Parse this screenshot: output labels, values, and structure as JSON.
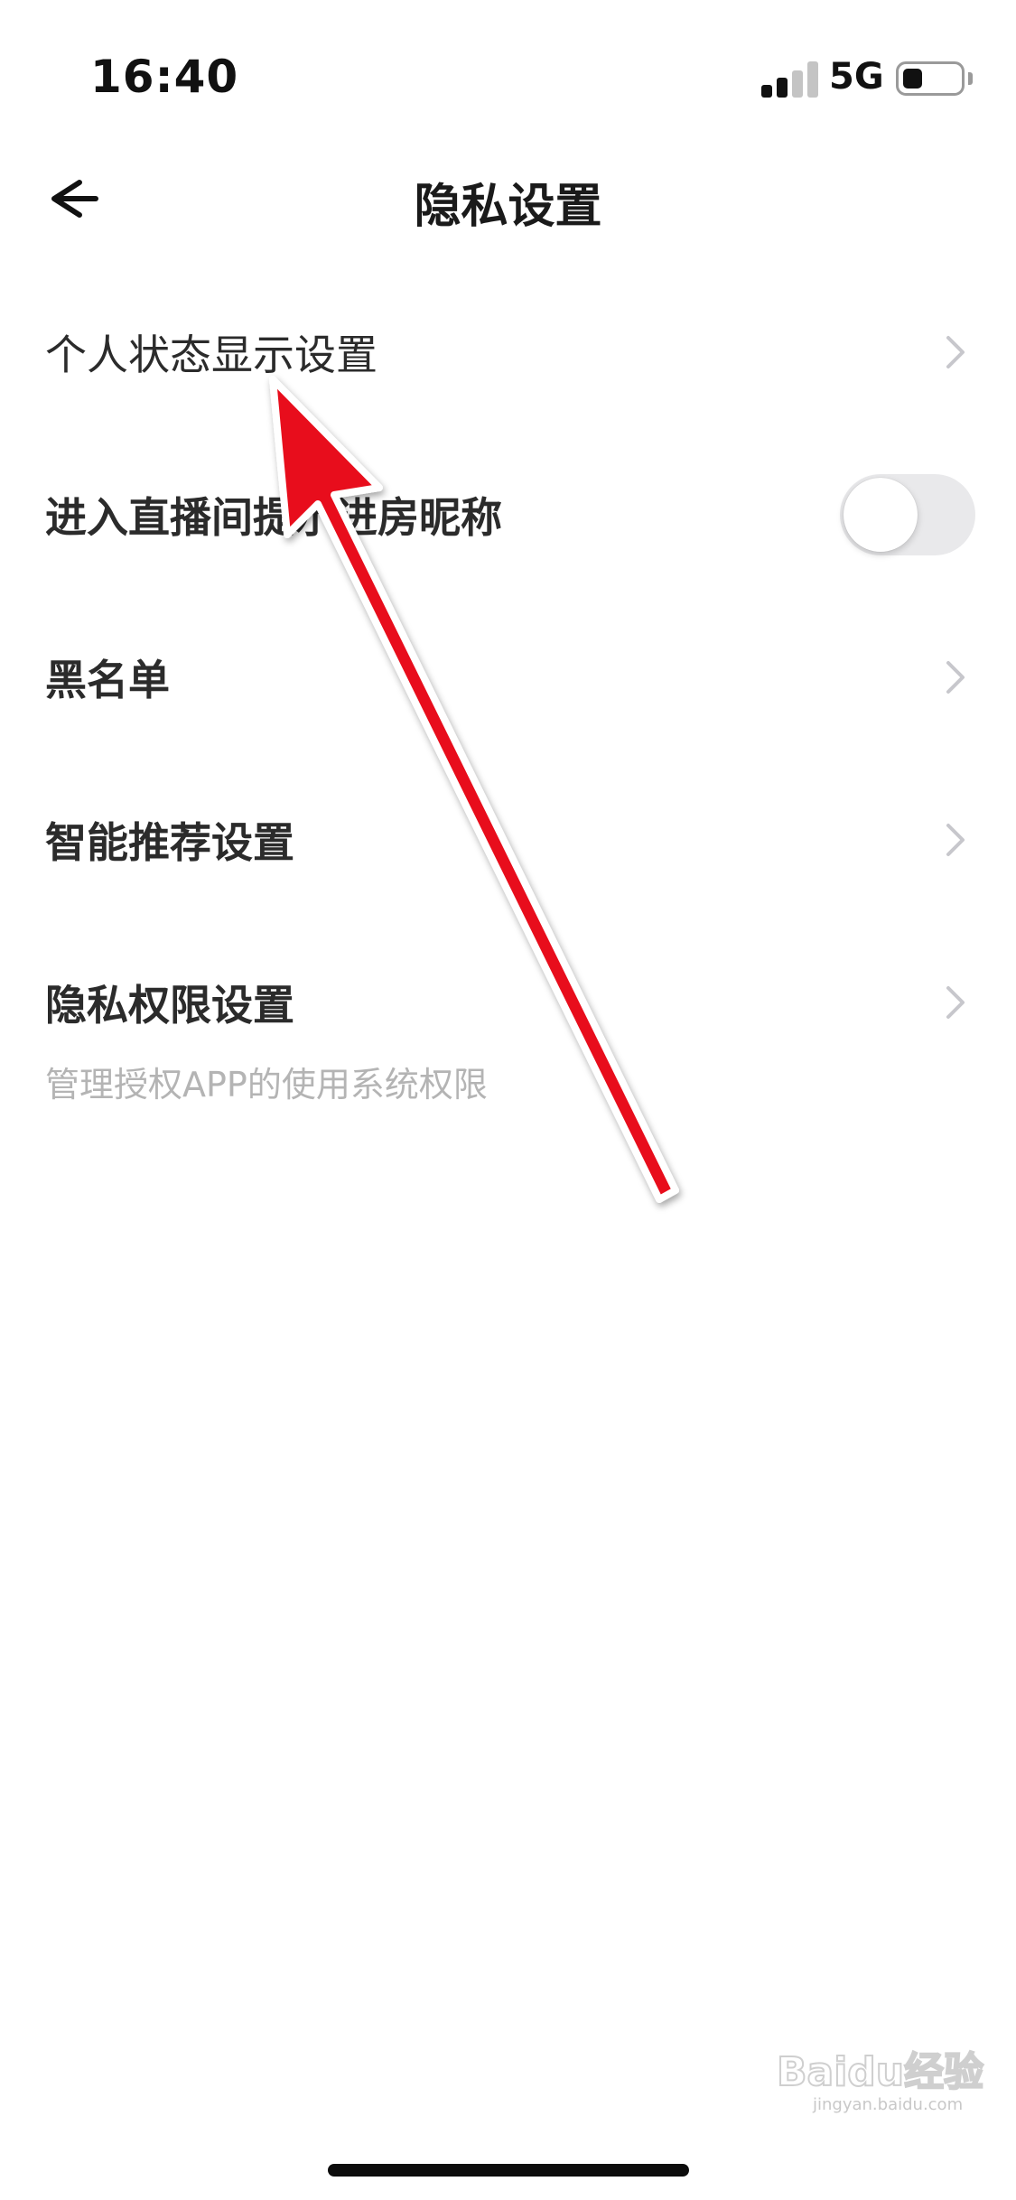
{
  "status_bar": {
    "time": "16:40",
    "network": "5G",
    "battery_level": 0.35,
    "signal_bars_active": 2,
    "signal_bars_total": 4
  },
  "nav": {
    "title": "隐私设置",
    "back_icon": "arrow-left-icon"
  },
  "settings": {
    "items": [
      {
        "label": "个人状态显示设置",
        "control": "chevron"
      },
      {
        "label": "进入直播间提示进房昵称",
        "control": "toggle",
        "enabled": false
      },
      {
        "label": "黑名单",
        "control": "chevron"
      },
      {
        "label": "智能推荐设置",
        "control": "chevron"
      },
      {
        "label": "隐私权限设置",
        "control": "chevron"
      }
    ],
    "caption": "管理授权APP的使用系统权限"
  },
  "annotation": {
    "icon": "red-arrow-annotation",
    "color": "#e8101c"
  },
  "watermark": {
    "text": "Baidu经验",
    "sub": "jingyan.baidu.com"
  },
  "colors": {
    "text_primary": "#2b2b2b",
    "text_secondary": "#b4b4b4",
    "toggle_off": "#e9e9eb",
    "chevron": "#c7c7cc"
  }
}
